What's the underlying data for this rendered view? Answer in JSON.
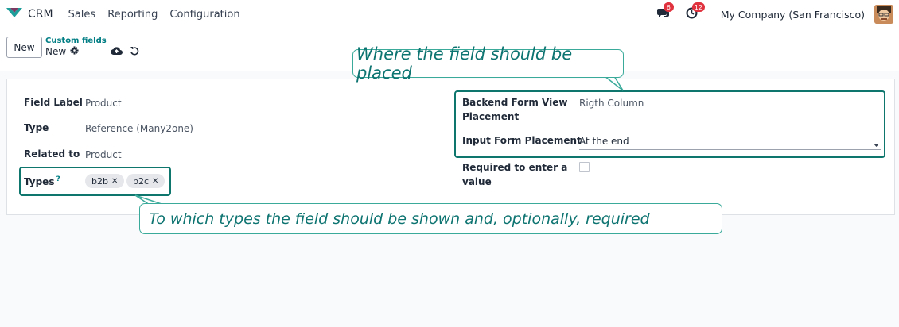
{
  "navbar": {
    "app_name": "CRM",
    "menu": [
      "Sales",
      "Reporting",
      "Configuration"
    ],
    "messages_count": "6",
    "activities_count": "12",
    "company": "My Company (San Francisco)"
  },
  "control": {
    "new_label": "New",
    "breadcrumb_parent": "Custom fields",
    "breadcrumb_current": "New"
  },
  "form": {
    "field_label": {
      "label": "Field Label",
      "value": "Product"
    },
    "type": {
      "label": "Type",
      "value": "Reference (Many2one)"
    },
    "related_to": {
      "label": "Related to",
      "value": "Product"
    },
    "types": {
      "label": "Types",
      "help": "?",
      "tags": [
        "b2b",
        "b2c"
      ]
    },
    "backend_placement": {
      "label_line1": "Backend Form View",
      "label_line2": "Placement",
      "value": "Rigth Column"
    },
    "input_placement": {
      "label": "Input Form Placement",
      "value": "At the end"
    },
    "required": {
      "label_line1": "Required to enter a",
      "label_line2": "value",
      "checked": false
    }
  },
  "annotations": {
    "placement_note": "Where the field should be placed",
    "types_note": "To which types the field should be shown and, optionally, required"
  },
  "colors": {
    "accent": "#017e84",
    "highlight": "#0f766e",
    "badge": "#e0323e"
  },
  "icons": [
    "crm-logo-icon",
    "chat-icon",
    "clock-icon",
    "gear-icon",
    "cloud-save-icon",
    "discard-icon",
    "caret-down-icon"
  ]
}
